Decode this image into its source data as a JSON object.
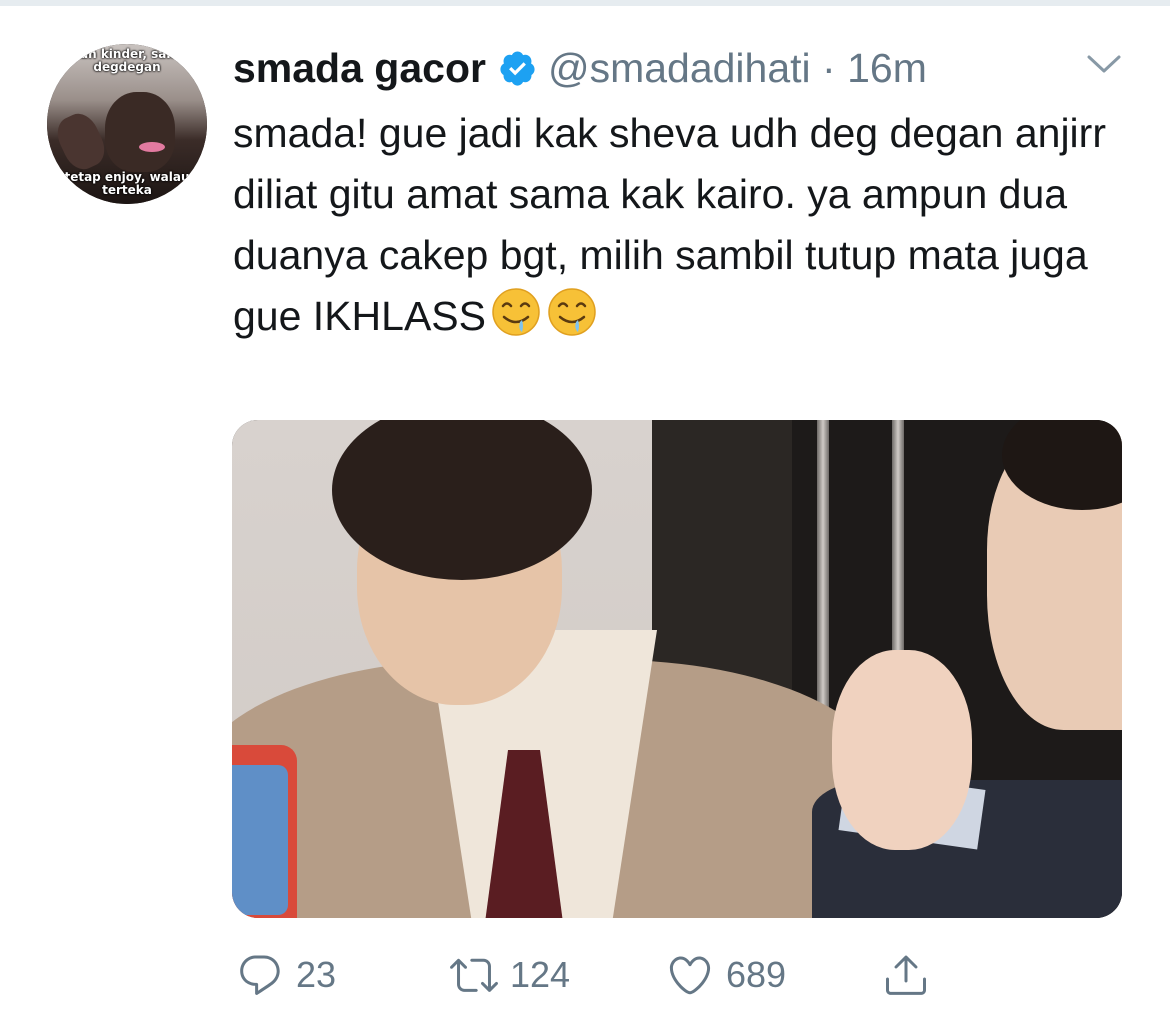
{
  "tweet": {
    "avatar": {
      "caption_top": "...kan kinder, sambil degdegan",
      "caption_bottom": "tetap enjoy, walau terteka",
      "icon": "avatar"
    },
    "display_name": "smada gacor",
    "verified": true,
    "handle_time": "@smadadihati · 16m",
    "text": "smada! gue jadi kak sheva udh deg degan anjirr diliat gitu amat sama kak kairo. ya ampun dua duanya cakep bgt, milih sambil tutup mata juga gue IKHLASS",
    "emojis": [
      "drooling-face-icon",
      "drooling-face-icon"
    ],
    "media": {
      "description_icon": "photo"
    },
    "actions": {
      "reply": {
        "icon": "reply-icon",
        "count": "23"
      },
      "retweet": {
        "icon": "retweet-icon",
        "count": "124"
      },
      "like": {
        "icon": "like-icon",
        "count": "689"
      },
      "share": {
        "icon": "share-icon"
      }
    },
    "more_icon": "chevron-down-icon"
  },
  "colors": {
    "text_primary": "#14171a",
    "text_secondary": "#657786",
    "verified_blue": "#1da1f2",
    "divider": "#e6ecf0"
  }
}
